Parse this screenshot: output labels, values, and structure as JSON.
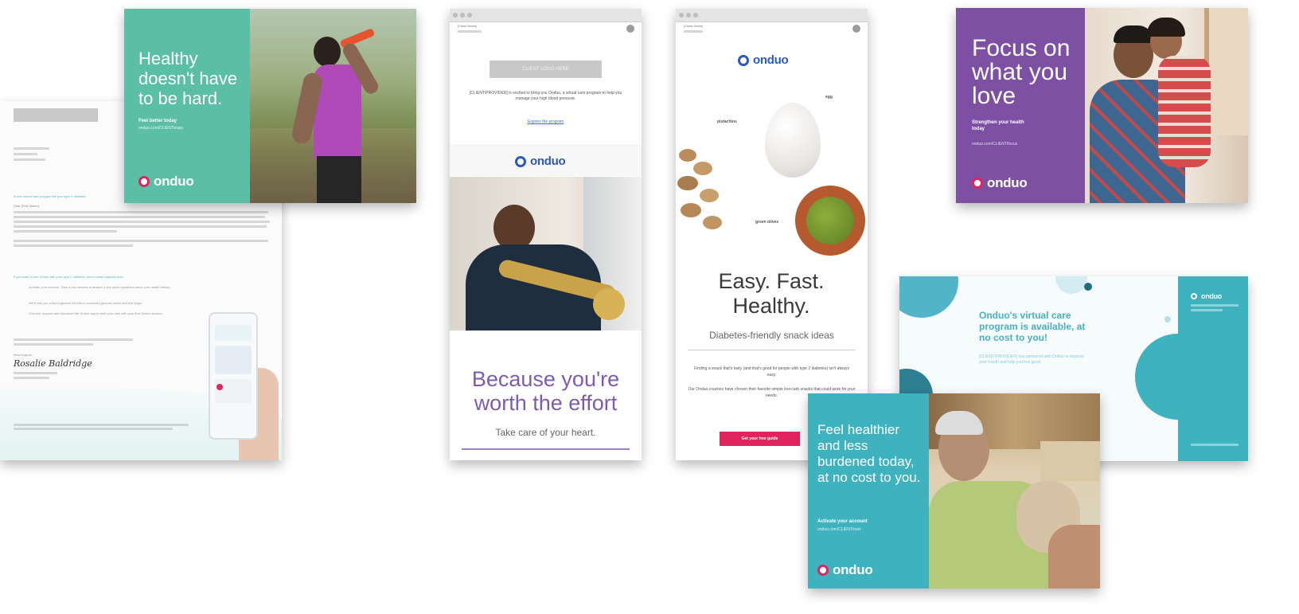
{
  "letter": {
    "greeting": "Dear [First Name],",
    "subject_line": "A new virtual care program for your type 2 diabetes",
    "section_heading": "If you want to join Onduo with your type 2 diabetes, here's what happens next:",
    "steps": [
      "Activate your account. Take a few minutes to answer a few quick questions about your health history.",
      "We'll mail you a blood glucose kit with a connected glucose meter and test strips.",
      "Connect, support and download the Onduo app to start your care with your first Onduo session."
    ],
    "signature": "Rosalie Baldridge",
    "signoff": "Best regards,"
  },
  "card_healthy": {
    "headline": "Healthy doesn't have to be hard.",
    "cta": "Feel better today",
    "url_line": "onduo.com/CLIENT/easy",
    "logo": "onduo",
    "bg": "#5bbfa5"
  },
  "email_trumpet": {
    "header_name": "[Client Name]",
    "button_label": "CLIENT LOGO HERE",
    "intro": "[CLIENT/PROVIDER] is excited to bring you Onduo, a virtual care program to help you manage your high blood pressure.",
    "link": "Explore the program",
    "logo": "onduo",
    "headline": "Because you're worth the effort",
    "subhead": "Take care of your heart.",
    "accent": "#7e5bb0"
  },
  "email_snacks": {
    "header_name": "[Client Name]",
    "logo": "onduo",
    "label_pistachios": "pistachios",
    "label_egg": "egg",
    "label_beans": "green olives",
    "headline": "Easy. Fast. Healthy.",
    "subhead": "Diabetes-friendly snack ideas",
    "body1": "Finding a snack that's tasty (and that's good for people with type 2 diabetes) isn't always easy.",
    "body2": "Our Onduo coaches have chosen their favorite simple low-carb snacks that could work for your needs.",
    "cta": "Get your free guide",
    "cta_color": "#e0245e"
  },
  "card_focus": {
    "headline": "Focus on what you love",
    "cta": "Strengthen your health today",
    "url_line": "onduo.com/CLIENT/focus",
    "logo": "onduo",
    "bg": "#7e50a4"
  },
  "postcard_teal": {
    "headline": "Onduo's virtual care program is available, at no cost to you!",
    "body": "[CLIENT/PROVIDER] has partnered with Onduo to improve your health and help you feel good.",
    "logo": "onduo",
    "accent": "#47b2c4"
  },
  "card_healthier": {
    "headline": "Feel healthier and less burdened today, at no cost to you.",
    "cta": "Activate your account",
    "url_line": "onduo.com/CLIENT/new",
    "logo": "onduo",
    "bg": "#3fb2bf"
  }
}
